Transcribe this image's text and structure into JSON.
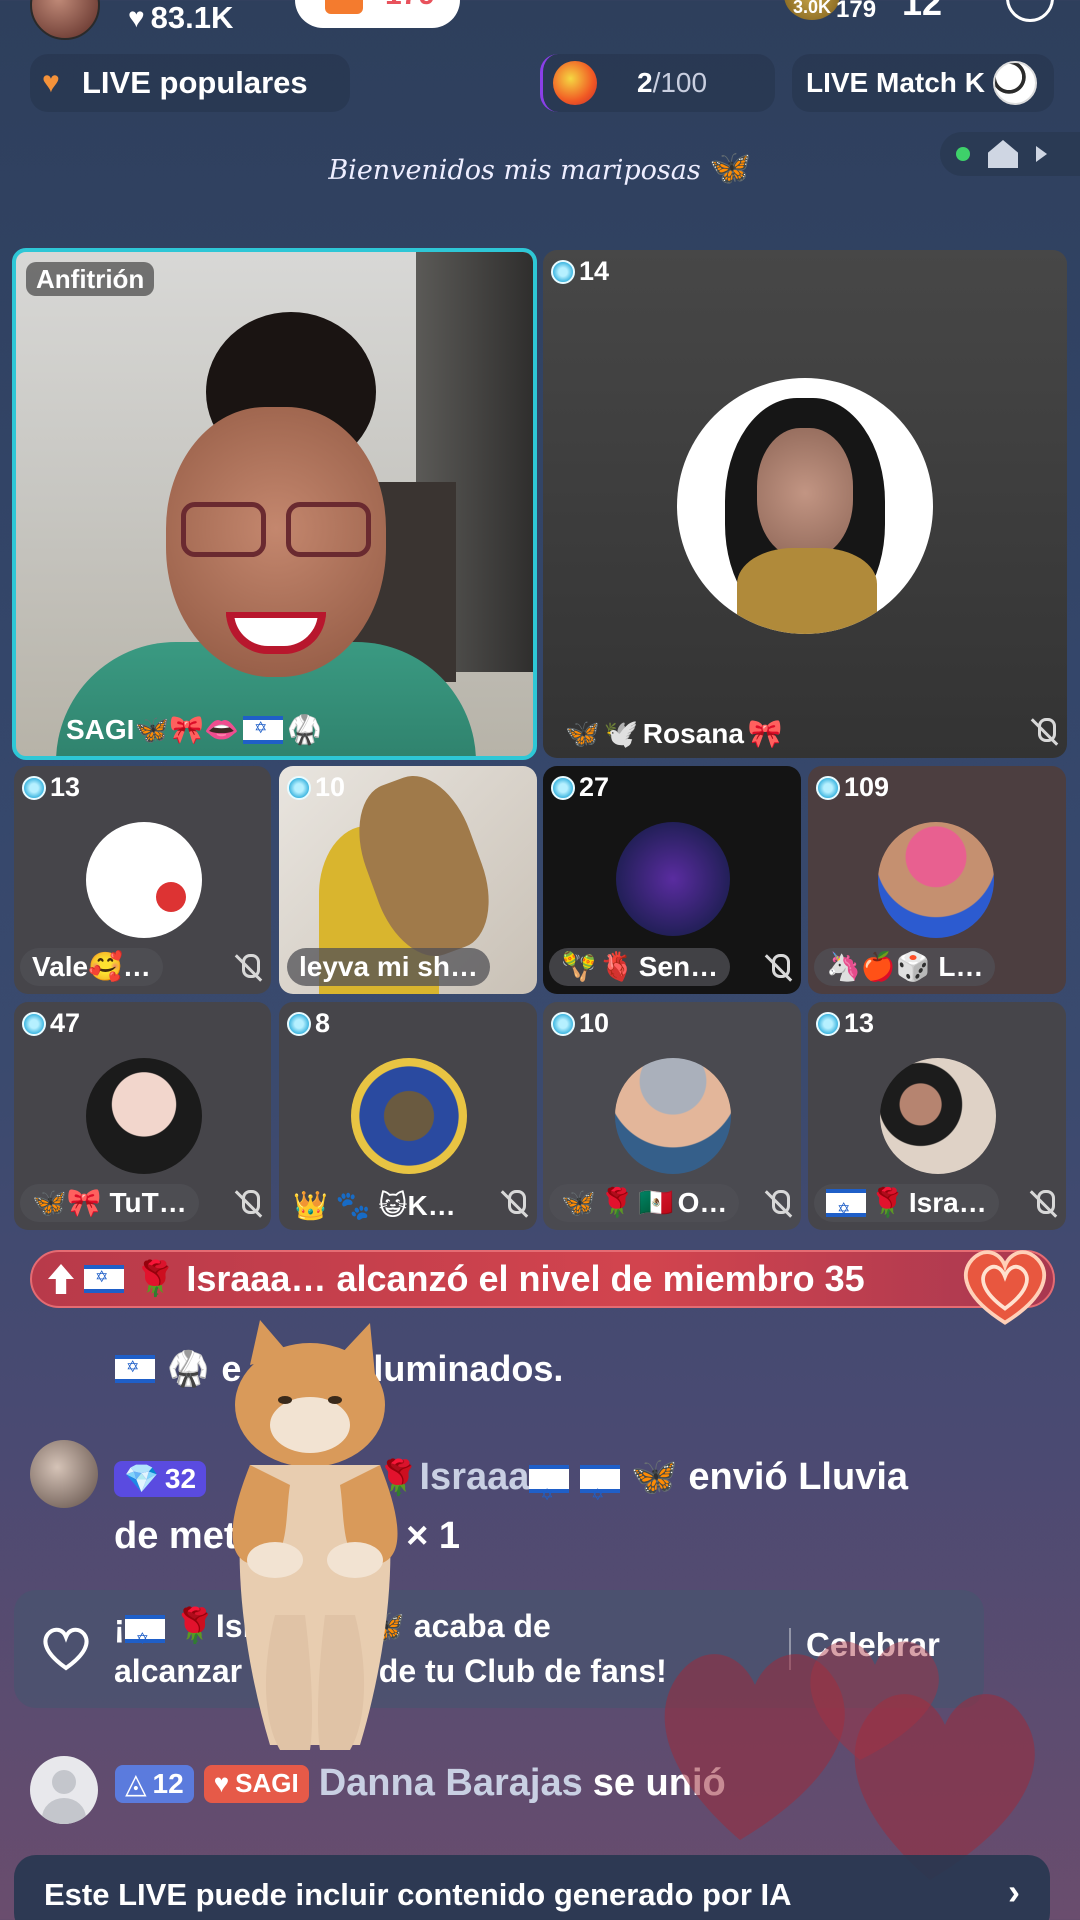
{
  "top": {
    "likes": "83.1K",
    "coin_badge": "3.0K",
    "viewers": "179",
    "count": "12",
    "pill_count": "179"
  },
  "nav": {
    "popular_label": "LIVE populares",
    "counter_current": "2",
    "counter_total": "/100",
    "match_label": "LIVE Match K"
  },
  "welcome": {
    "text": "Bienvenidos mis mariposas",
    "emoji": "🦋"
  },
  "host_tile": {
    "role_label": "Anfitrión",
    "name": "SAGI🦋🎀👄"
  },
  "guests": [
    {
      "count": "14",
      "name": "Rosana"
    },
    {
      "count": "13",
      "name": "Vale🥰…"
    },
    {
      "count": "10",
      "name": "leyva mi sh…"
    },
    {
      "count": "27",
      "name": "Sen…"
    },
    {
      "count": "109",
      "name": "🦄🍎🎲 L…"
    },
    {
      "count": "47",
      "name": "🦋🎀 TuT…"
    },
    {
      "count": "8",
      "name": "👑 🐾 😺K…"
    },
    {
      "count": "10",
      "name": "O…"
    },
    {
      "count": "13",
      "name": "Isra…"
    }
  ],
  "chat": {
    "level_banner": "Israaa… alcanzó el nivel de miembro 35",
    "line1": "luminados.",
    "line1_prefix": "e",
    "line2_level": "32",
    "line2_name": "Israaa",
    "line2_text": "envió Lluvia",
    "line2_text2": "de met",
    "line2_text3": "s",
    "line2_mult": "× 1",
    "fan_text_a": "¡",
    "fan_text_b": "Isr",
    "fan_text_c": "acaba de",
    "fan_text_d": "alcanzar",
    "fan_text_e": "5 de tu Club de fans!",
    "celebrate_label": "Celebrar",
    "line3_level": "12",
    "line3_fan_badge": "SAGI",
    "line3_name": "Danna Barajas",
    "line3_text": "se unió"
  },
  "ai_notice": "Este LIVE puede incluir contenido generado por IA",
  "colors": {
    "host_border": "#2ec7d6",
    "banner_red": "#d2444e",
    "level_purple": "#5a4be0",
    "level_blue": "#5b7bdd",
    "fan_orange": "#e65a48"
  }
}
